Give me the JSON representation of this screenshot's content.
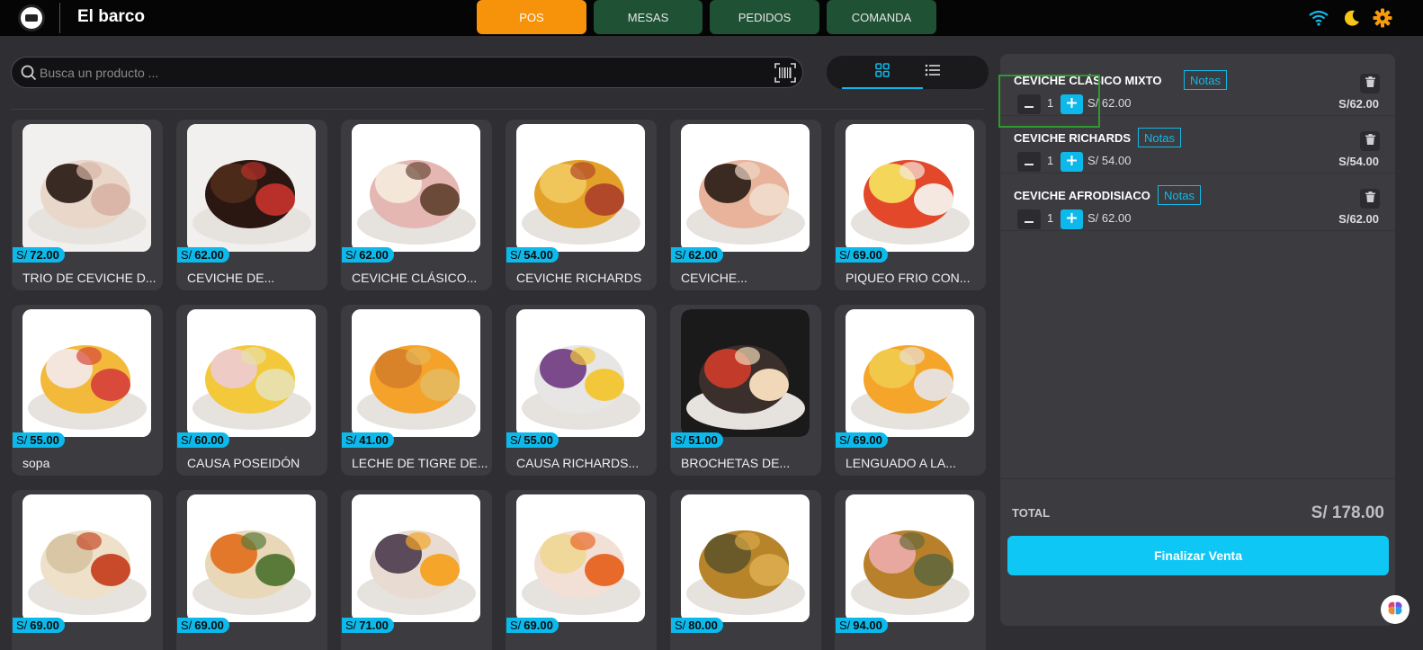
{
  "app": {
    "title": "El barco"
  },
  "nav": [
    {
      "label": "POS",
      "active": true
    },
    {
      "label": "MESAS",
      "active": false
    },
    {
      "label": "PEDIDOS",
      "active": false
    },
    {
      "label": "COMANDA",
      "active": false
    }
  ],
  "topbar_icons": [
    "wifi-icon",
    "moon-icon",
    "gear-icon"
  ],
  "colors": {
    "accent": "#0cb9ea",
    "active_tab": "#f7920b",
    "tab": "#1f5134",
    "topbar": "#050505"
  },
  "search": {
    "placeholder": "Busca un producto ..."
  },
  "view": {
    "mode": "grid"
  },
  "currency": "S/",
  "products": [
    {
      "price": "72.00",
      "name": "TRIO DE CEVICHE D...",
      "colors": [
        "#e9d7c9",
        "#3a2a24",
        "#d9b6a8",
        "#f2f0ee"
      ]
    },
    {
      "price": "62.00",
      "name": "CEVICHE DE...",
      "colors": [
        "#2a1712",
        "#4b2a1a",
        "#b9302a",
        "#f2f0ee"
      ]
    },
    {
      "price": "62.00",
      "name": "CEVICHE CLÁSICO...",
      "colors": [
        "#e5b7b2",
        "#f4e6d9",
        "#6b4a3a",
        "#ffffff"
      ]
    },
    {
      "price": "54.00",
      "name": "CEVICHE RICHARDS",
      "colors": [
        "#e3a12a",
        "#f0c55a",
        "#b2482a",
        "#ffffff"
      ]
    },
    {
      "price": "62.00",
      "name": "CEVICHE...",
      "colors": [
        "#e8b39a",
        "#3b2a22",
        "#f0d9c8",
        "#ffffff"
      ]
    },
    {
      "price": "69.00",
      "name": "PIQUEO FRIO CON...",
      "colors": [
        "#e3482a",
        "#f3d65a",
        "#f4e8e0",
        "#ffffff"
      ]
    },
    {
      "price": "55.00",
      "name": "sopa",
      "colors": [
        "#f2b93a",
        "#f4e6dc",
        "#d94a3a",
        "#ffffff"
      ]
    },
    {
      "price": "60.00",
      "name": "CAUSA POSEIDÓN",
      "colors": [
        "#f3c83a",
        "#eecbc4",
        "#e8e0a8",
        "#ffffff"
      ]
    },
    {
      "price": "41.00",
      "name": "LECHE DE TIGRE DE...",
      "colors": [
        "#f4a22a",
        "#d8822a",
        "#e6b85a",
        "#ffffff"
      ]
    },
    {
      "price": "55.00",
      "name": "CAUSA RICHARDS...",
      "colors": [
        "#e8e6e4",
        "#7a4a8a",
        "#f2c83a",
        "#ffffff"
      ]
    },
    {
      "price": "51.00",
      "name": "BROCHETAS DE...",
      "colors": [
        "#3a2f2b",
        "#c23a2a",
        "#f0d8b8",
        "#1a1a1a"
      ]
    },
    {
      "price": "69.00",
      "name": "LENGUADO A LA...",
      "colors": [
        "#f4a52a",
        "#f2c84a",
        "#e8e0d8",
        "#ffffff"
      ]
    },
    {
      "price": "69.00",
      "name": "",
      "colors": [
        "#efe1c9",
        "#d9c6a4",
        "#c84a2a",
        "#ffffff"
      ]
    },
    {
      "price": "69.00",
      "name": "",
      "colors": [
        "#e8d8b8",
        "#e3782a",
        "#5a7a3a",
        "#ffffff"
      ]
    },
    {
      "price": "71.00",
      "name": "",
      "colors": [
        "#e8dcd2",
        "#5a4a5a",
        "#f4a52a",
        "#ffffff"
      ]
    },
    {
      "price": "69.00",
      "name": "",
      "colors": [
        "#f2e0d6",
        "#f0d89a",
        "#e86a2a",
        "#ffffff"
      ]
    },
    {
      "price": "80.00",
      "name": "",
      "colors": [
        "#b8842a",
        "#6a5a2a",
        "#d8a84a",
        "#ffffff"
      ]
    },
    {
      "price": "94.00",
      "name": "",
      "colors": [
        "#b8802a",
        "#e8a8a0",
        "#6a6a3a",
        "#ffffff"
      ]
    }
  ],
  "cart": {
    "notes_label": "Notas",
    "items": [
      {
        "name": "CEVICHE CLÁSICO MIXTO",
        "qty": "1",
        "unit_price": "S/ 62.00",
        "total": "S/62.00"
      },
      {
        "name": "CEVICHE RICHARDS",
        "qty": "1",
        "unit_price": "S/ 54.00",
        "total": "S/54.00"
      },
      {
        "name": "CEVICHE AFRODISIACO",
        "qty": "1",
        "unit_price": "S/ 62.00",
        "total": "S/62.00"
      }
    ],
    "total_label": "TOTAL",
    "total_value": "S/ 178.00",
    "finalize_label": "Finalizar Venta"
  }
}
